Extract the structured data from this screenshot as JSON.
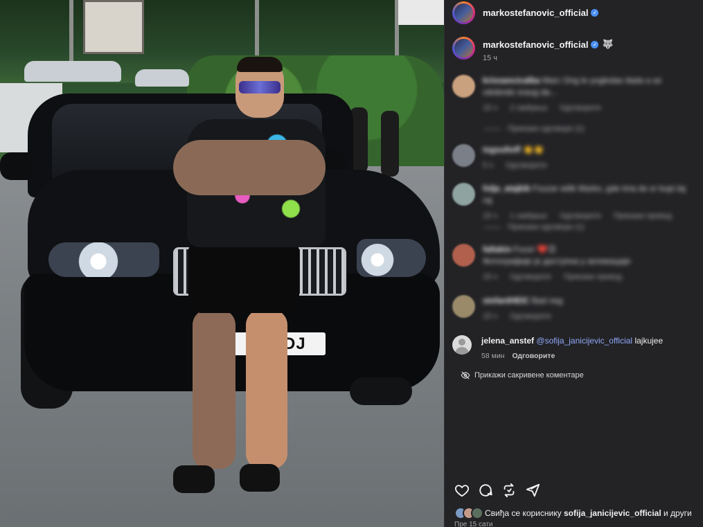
{
  "post": {
    "author_handle": "markostefanovic_official",
    "plate_text": "IS 4-DJ"
  },
  "caption": {
    "handle": "markostefanovic_official",
    "emoji": "🐺",
    "time": "15 ч"
  },
  "comments_blurred": [
    {
      "handle": "krissancicalba",
      "text": "Marc Ong le yogledas tlada a se odobndo sraug da...",
      "meta1": "15 ч",
      "meta2": "2 свиђања",
      "meta3": "Одговорите",
      "replies": "Прикажи одговоре (1)"
    },
    {
      "handle": "tsgsultoff",
      "text": "👏👏",
      "meta1": "5 ч",
      "meta2": "Одговорите",
      "meta3": ""
    },
    {
      "handle": "folja_atajkik",
      "text": "Fsuzar wilik Marko, gde tma do sr kupi taj raj",
      "meta1": "15 ч",
      "meta2": "1 свиђање",
      "meta3": "Одговорите",
      "meta4": "Прикажи превод",
      "replies": "Прикажи одговоре (1)"
    },
    {
      "handle": "fallakin",
      "text": "Fucer ❤️😊",
      "text2": "Фотографије је доступна у апликацији",
      "meta1": "15 ч",
      "meta2": "Одговорите",
      "meta3": "Прикажи превод"
    },
    {
      "handle": "stefanIHEIC",
      "text": "Bad neg",
      "meta1": "15 ч",
      "meta2": "Одговорите",
      "meta3": ""
    }
  ],
  "comment_visible": {
    "handle": "jelena_anstef",
    "mention": "@sofija_janicijevic_official",
    "text": "lajkujee",
    "time": "58 мин",
    "reply": "Одговорите"
  },
  "hidden_comments_label": "Прикажи сакривене коментаре",
  "likes": {
    "prefix": "Свиђа се кориснику",
    "user": "sofija_janicijevic_official",
    "suffix": "и други"
  },
  "posted_time": "Пре 15 сати",
  "icons": [
    "heart-icon",
    "comment-icon",
    "repost-icon",
    "share-icon",
    "eye-off-icon",
    "verified-icon"
  ],
  "colors": {
    "panel_bg": "#232326",
    "accent_verified": "#4a8ff2",
    "mention": "#8fa8f7"
  }
}
